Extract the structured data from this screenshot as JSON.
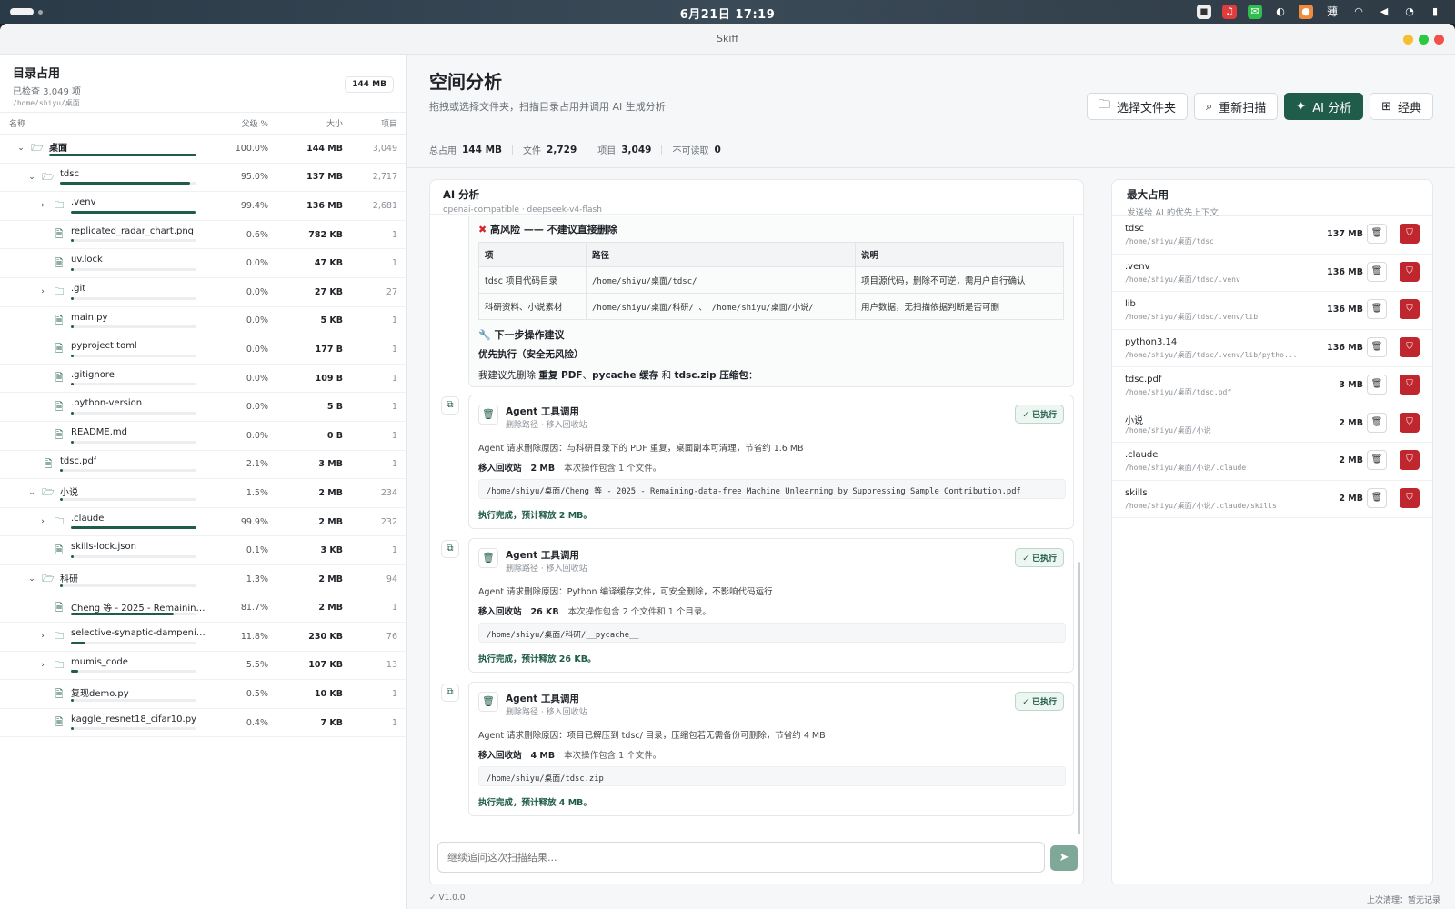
{
  "system": {
    "clock": "6月21日  17:19",
    "input_method": "薄"
  },
  "window": {
    "title": "Skiff"
  },
  "left": {
    "title": "目录占用",
    "checked": "已检查 3,049 项",
    "path": "/home/shiyu/桌面",
    "badge": "144 MB",
    "cols": {
      "name": "名称",
      "pct": "父级 %",
      "size": "大小",
      "count": "项目"
    },
    "rows": [
      {
        "depth": 0,
        "chev": "v",
        "type": "folder-open",
        "name": "桌面",
        "pct": "100.0%",
        "size": "144 MB",
        "count": "3,049",
        "frac": 1.0,
        "bold": true
      },
      {
        "depth": 1,
        "chev": "v",
        "type": "folder-open",
        "name": "tdsc",
        "pct": "95.0%",
        "size": "137 MB",
        "count": "2,717",
        "frac": 0.95,
        "bold": false
      },
      {
        "depth": 2,
        "chev": ">",
        "type": "folder",
        "name": ".venv",
        "pct": "99.4%",
        "size": "136 MB",
        "count": "2,681",
        "frac": 0.994,
        "bold": false
      },
      {
        "depth": 2,
        "chev": "",
        "type": "file",
        "name": "replicated_radar_chart.png",
        "pct": "0.6%",
        "size": "782 KB",
        "count": "1",
        "frac": 0.006
      },
      {
        "depth": 2,
        "chev": "",
        "type": "file",
        "name": "uv.lock",
        "pct": "0.0%",
        "size": "47 KB",
        "count": "1",
        "frac": 0.0
      },
      {
        "depth": 2,
        "chev": ">",
        "type": "folder",
        "name": ".git",
        "pct": "0.0%",
        "size": "27 KB",
        "count": "27",
        "frac": 0.0
      },
      {
        "depth": 2,
        "chev": "",
        "type": "file",
        "name": "main.py",
        "pct": "0.0%",
        "size": "5 KB",
        "count": "1",
        "frac": 0.0
      },
      {
        "depth": 2,
        "chev": "",
        "type": "file",
        "name": "pyproject.toml",
        "pct": "0.0%",
        "size": "177 B",
        "count": "1",
        "frac": 0.0
      },
      {
        "depth": 2,
        "chev": "",
        "type": "file",
        "name": ".gitignore",
        "pct": "0.0%",
        "size": "109 B",
        "count": "1",
        "frac": 0.0
      },
      {
        "depth": 2,
        "chev": "",
        "type": "file",
        "name": ".python-version",
        "pct": "0.0%",
        "size": "5 B",
        "count": "1",
        "frac": 0.0
      },
      {
        "depth": 2,
        "chev": "",
        "type": "file",
        "name": "README.md",
        "pct": "0.0%",
        "size": "0 B",
        "count": "1",
        "frac": 0.0
      },
      {
        "depth": 1,
        "chev": "",
        "type": "file",
        "name": "tdsc.pdf",
        "pct": "2.1%",
        "size": "3 MB",
        "count": "1",
        "frac": 0.021
      },
      {
        "depth": 1,
        "chev": "v",
        "type": "folder-open",
        "name": "小说",
        "pct": "1.5%",
        "size": "2 MB",
        "count": "234",
        "frac": 0.015
      },
      {
        "depth": 2,
        "chev": ">",
        "type": "folder",
        "name": ".claude",
        "pct": "99.9%",
        "size": "2 MB",
        "count": "232",
        "frac": 0.999
      },
      {
        "depth": 2,
        "chev": "",
        "type": "file",
        "name": "skills-lock.json",
        "pct": "0.1%",
        "size": "3 KB",
        "count": "1",
        "frac": 0.001
      },
      {
        "depth": 1,
        "chev": "v",
        "type": "folder-open",
        "name": "科研",
        "pct": "1.3%",
        "size": "2 MB",
        "count": "94",
        "frac": 0.013
      },
      {
        "depth": 2,
        "chev": "",
        "type": "file",
        "name": "Cheng 等 - 2025 - Remaining-d...",
        "pct": "81.7%",
        "size": "2 MB",
        "count": "1",
        "frac": 0.817
      },
      {
        "depth": 2,
        "chev": ">",
        "type": "folder",
        "name": "selective-synaptic-dampening",
        "pct": "11.8%",
        "size": "230 KB",
        "count": "76",
        "frac": 0.118
      },
      {
        "depth": 2,
        "chev": ">",
        "type": "folder",
        "name": "mumis_code",
        "pct": "5.5%",
        "size": "107 KB",
        "count": "13",
        "frac": 0.055
      },
      {
        "depth": 2,
        "chev": "",
        "type": "file",
        "name": "复现demo.py",
        "pct": "0.5%",
        "size": "10 KB",
        "count": "1",
        "frac": 0.005
      },
      {
        "depth": 2,
        "chev": "",
        "type": "file",
        "name": "kaggle_resnet18_cifar10.py",
        "pct": "0.4%",
        "size": "7 KB",
        "count": "1",
        "frac": 0.004
      }
    ]
  },
  "main": {
    "title": "空间分析",
    "desc": "拖拽或选择文件夹，扫描目录占用并调用 AI 生成分析",
    "toolbar": {
      "choose": "选择文件夹",
      "rescan": "重新扫描",
      "ai": "AI 分析",
      "classic": "经典"
    },
    "stats": {
      "total_l": "总占用",
      "total": "144 MB",
      "files_l": "文件",
      "files": "2,729",
      "items_l": "项目",
      "items": "3,049",
      "unread_l": "不可读取",
      "unread": "0"
    },
    "ai": {
      "title": "AI 分析",
      "model": "openai-compatible · deepseek-v4-flash",
      "risk_title": "高风险 —— 不建议直接删除",
      "table_head": [
        "项",
        "路径",
        "说明"
      ],
      "table_rows": [
        [
          "tdsc 项目代码目录",
          "/home/shiyu/桌面/tdsc/",
          "项目源代码，删除不可逆，需用户自行确认"
        ],
        [
          "科研资料、小说素材",
          "/home/shiyu/桌面/科研/ 、 /home/shiyu/桌面/小说/",
          "用户数据，无扫描依据判断是否可删"
        ]
      ],
      "next_title": "下一步操作建议",
      "priority": "优先执行（安全无风险）",
      "suggest_pre": "我建议先删除 ",
      "suggest_a": "重复 PDF",
      "suggest_sep1": "、",
      "suggest_b": "pycache 缓存",
      "suggest_sep2": " 和 ",
      "suggest_c": "tdsc.zip 压缩包",
      "suggest_post": "：",
      "tool_calls": [
        {
          "title": "Agent 工具调用",
          "sub": "删除路径 · 移入回收站",
          "status": "已执行",
          "reason": "Agent 请求删除原因：与科研目录下的 PDF 重复，桌面副本可清理，节省约 1.6 MB",
          "move_l": "移入回收站",
          "size": "2 MB",
          "include": "本次操作包含 1 个文件。",
          "path": "/home/shiyu/桌面/Cheng 等 - 2025 - Remaining-data-free Machine Unlearning by Suppressing Sample Contribution.pdf",
          "result": "执行完成，预计释放 2 MB。"
        },
        {
          "title": "Agent 工具调用",
          "sub": "删除路径 · 移入回收站",
          "status": "已执行",
          "reason": "Agent 请求删除原因：Python 编译缓存文件，可安全删除，不影响代码运行",
          "move_l": "移入回收站",
          "size": "26 KB",
          "include": "本次操作包含 2 个文件和 1 个目录。",
          "path": "/home/shiyu/桌面/科研/__pycache__",
          "result": "执行完成，预计释放 26 KB。"
        },
        {
          "title": "Agent 工具调用",
          "sub": "删除路径 · 移入回收站",
          "status": "已执行",
          "reason": "Agent 请求删除原因：项目已解压到 tdsc/ 目录，压缩包若无需备份可删除，节省约 4 MB",
          "move_l": "移入回收站",
          "size": "4 MB",
          "include": "本次操作包含 1 个文件。",
          "path": "/home/shiyu/桌面/tdsc.zip",
          "result": "执行完成，预计释放 4 MB。"
        }
      ],
      "input_placeholder": "继续追问这次扫描结果..."
    },
    "side": {
      "title": "最大占用",
      "sub": "发送给 AI 的优先上下文",
      "items": [
        {
          "name": "tdsc",
          "path": "/home/shiyu/桌面/tdsc",
          "size": "137 MB"
        },
        {
          "name": ".venv",
          "path": "/home/shiyu/桌面/tdsc/.venv",
          "size": "136 MB"
        },
        {
          "name": "lib",
          "path": "/home/shiyu/桌面/tdsc/.venv/lib",
          "size": "136 MB"
        },
        {
          "name": "python3.14",
          "path": "/home/shiyu/桌面/tdsc/.venv/lib/pytho...",
          "size": "136 MB"
        },
        {
          "name": "tdsc.pdf",
          "path": "/home/shiyu/桌面/tdsc.pdf",
          "size": "3 MB"
        },
        {
          "name": "小说",
          "path": "/home/shiyu/桌面/小说",
          "size": "2 MB"
        },
        {
          "name": ".claude",
          "path": "/home/shiyu/桌面/小说/.claude",
          "size": "2 MB"
        },
        {
          "name": "skills",
          "path": "/home/shiyu/桌面/小说/.claude/skills",
          "size": "2 MB"
        }
      ]
    },
    "footer": {
      "version": "V1.0.0",
      "last_clean": "上次清理：暂无记录"
    }
  },
  "colors": {
    "accent": "#1f5c4a",
    "danger": "#c0262d"
  }
}
